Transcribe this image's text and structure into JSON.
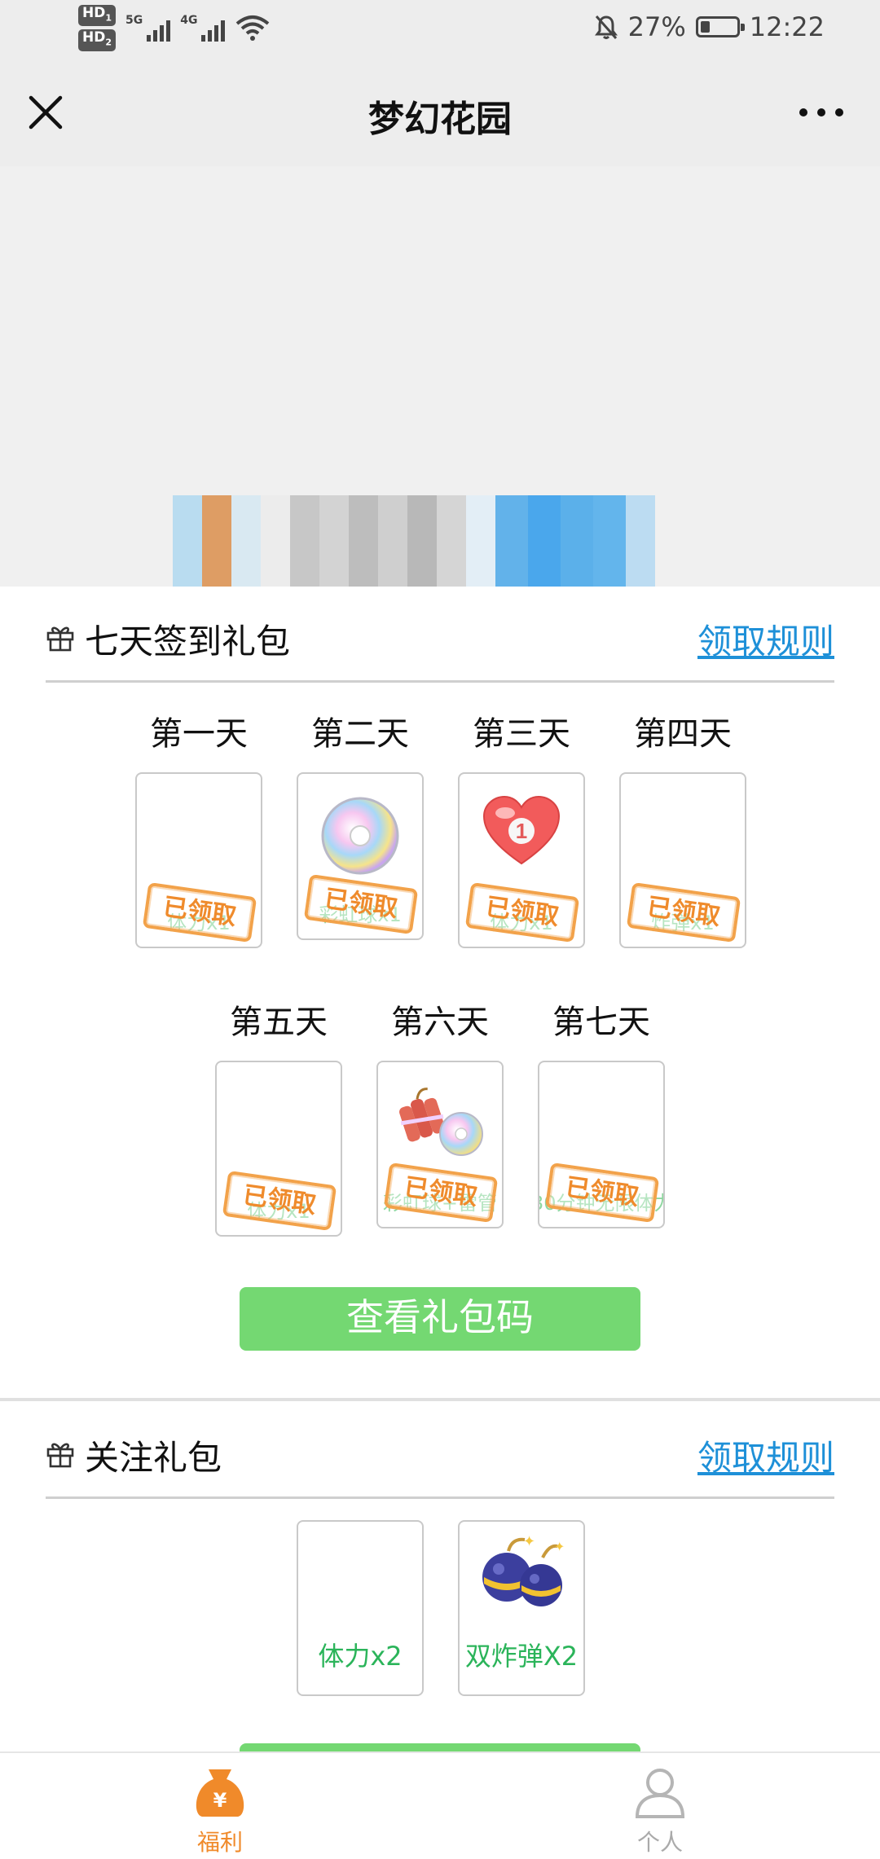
{
  "status_bar": {
    "hd1": "HD",
    "hd1_sub": "1",
    "hd2": "HD",
    "hd2_sub": "2",
    "net1": "5G",
    "net2": "4G",
    "battery_percent": "27%",
    "battery_level": 0.27,
    "time": "12:22"
  },
  "nav": {
    "title": "梦幻花园",
    "close_icon": "close-icon",
    "more_icon": "more-icon"
  },
  "signin_section": {
    "title": "七天签到礼包",
    "rules_link": "领取规则",
    "days": [
      {
        "label": "第一天",
        "item": "体力x1",
        "stamp": "已领取"
      },
      {
        "label": "第二天",
        "item": "彩虹球x1",
        "stamp": "已领取"
      },
      {
        "label": "第三天",
        "item": "体力x1",
        "stamp": "已领取"
      },
      {
        "label": "第四天",
        "item": "炸弹x1",
        "stamp": "已领取"
      },
      {
        "label": "第五天",
        "item": "体力x1",
        "stamp": "已领取"
      },
      {
        "label": "第六天",
        "item": "彩虹球+雷管",
        "stamp": "已领取"
      },
      {
        "label": "第七天",
        "item": "30分钟无限体力",
        "stamp": "已领取"
      }
    ],
    "button": "查看礼包码"
  },
  "follow_section": {
    "title": "关注礼包",
    "rules_link": "领取规则",
    "items": [
      {
        "name": "体力x2"
      },
      {
        "name": "双炸弹X2"
      }
    ]
  },
  "tabbar": {
    "tabs": [
      {
        "label": "福利",
        "icon": "welfare-bag-icon",
        "active": true
      },
      {
        "label": "个人",
        "icon": "person-icon",
        "active": false
      }
    ]
  },
  "colors": {
    "accent_orange": "#f08a2a",
    "link_blue": "#1e90d8",
    "button_green": "#74d872",
    "item_green": "#2bb45a"
  }
}
